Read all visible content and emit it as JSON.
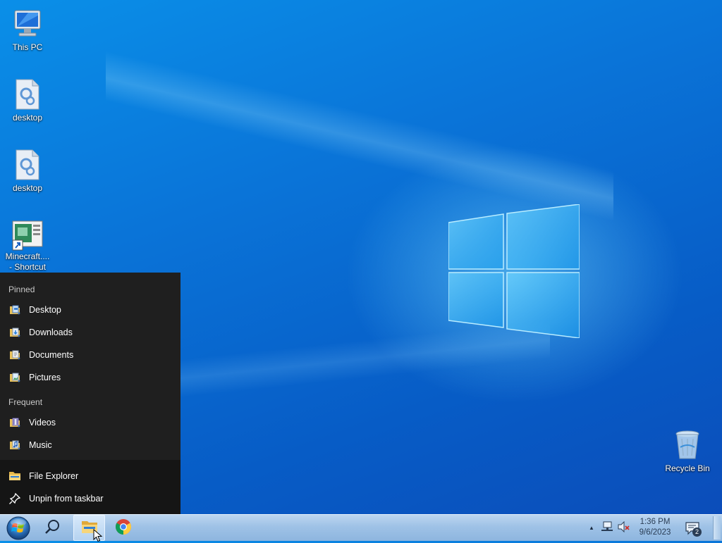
{
  "desktop": {
    "icons": [
      {
        "label": "This PC",
        "icon": "this-pc-icon"
      },
      {
        "label": "desktop",
        "icon": "settings-file-icon"
      },
      {
        "label": "desktop",
        "icon": "settings-file-icon"
      },
      {
        "label": "Minecraft....\n- Shortcut",
        "icon": "minecraft-shortcut-icon"
      },
      {
        "label": "Recycle Bin",
        "icon": "recycle-bin-icon"
      }
    ]
  },
  "jumplist": {
    "pinned_header": "Pinned",
    "pinned": [
      "Desktop",
      "Downloads",
      "Documents",
      "Pictures"
    ],
    "frequent_header": "Frequent",
    "frequent": [
      "Videos",
      "Music"
    ],
    "actions": [
      "File Explorer",
      "Unpin from taskbar"
    ]
  },
  "taskbar": {
    "items": [
      "start-button",
      "search-icon",
      "file-explorer-icon",
      "chrome-icon"
    ],
    "clock": {
      "time": "1:36 PM",
      "date": "9/6/2023"
    },
    "notifications_count": "2"
  },
  "colors": {
    "accent": "#0a74d8",
    "jumplist_bg": "#1f1f1f",
    "taskbar_bg": "#9fc2e6"
  }
}
